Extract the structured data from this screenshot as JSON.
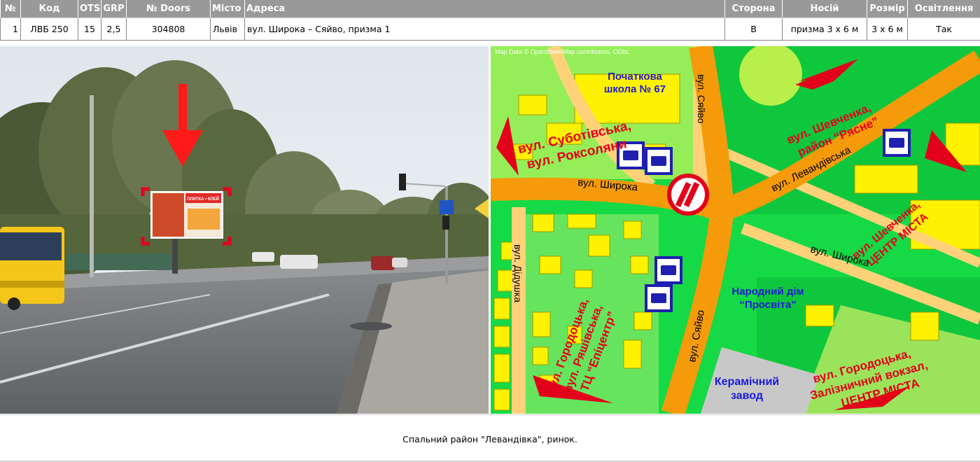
{
  "table": {
    "headers": [
      "№",
      "Код",
      "OTS",
      "GRP",
      "№ Doors",
      "Місто",
      "Адреса",
      "Сторона",
      "Носій",
      "Розмір",
      "Освітлення"
    ],
    "row": {
      "num": "1",
      "code": "ЛВБ 250",
      "ots": "15",
      "grp": "2,5",
      "doors": "304808",
      "city": "Львів",
      "address": "вул. Широка – Сяйво, призма 1",
      "side": "В",
      "carrier": "призма 3 х 6 м",
      "size": "3 х 6 м",
      "lighting": "Так"
    }
  },
  "billboard": {
    "brand_text": "ПЛИТКА • КЛЕЙ"
  },
  "map": {
    "attribution": "Map Data © OpenStreetMap contributors, ODbL",
    "labels": {
      "school_line1": "Початкова",
      "school_line2": "школа № 67",
      "subotivska_line1": "вул. Суботівська,",
      "subotivska_line2": "вул. Роксоляни",
      "shevchenka_top_line1": "вул. Шевченка,",
      "shevchenka_top_line2": "район “Рясне”",
      "syaivo_top": "вул. Сяйво",
      "levandivska": "вул. Левандівська",
      "shyroka_left": "вул. Широка",
      "shevchenka_right_line1": "вул. Шевченка,",
      "shevchenka_right_line2": "ЦЕНТР МІСТА",
      "shyroka_right": "вул. Широка",
      "didushka": "вул. Дідушка",
      "gorodotska_left_line1": "вул. Городоцька,",
      "gorodotska_left_line2": "вул. Ряшівська,",
      "gorodotska_left_line3": "ТЦ “Епіцентр”",
      "syaivo_bottom": "вул. Сяйво",
      "narodnyi_line1": "Народний дім",
      "narodnyi_line2": "“Просвіта”",
      "ceramic_line1": "Керамічний",
      "ceramic_line2": "завод",
      "gorodotska_right_line1": "вул. Городоцька,",
      "gorodotska_right_line2": "Залізничний вокзал,",
      "gorodotska_right_line3": "ЦЕНТР МІСТА"
    }
  },
  "caption": "Спальний район \"Левандівка\", ринок.",
  "colors": {
    "header_bg": "#999999",
    "map_green": "#16d946",
    "map_dark_green": "#0cb334",
    "map_road": "#ffd27a",
    "map_main_road": "#f59b0b",
    "map_building": "#fff200",
    "map_label_red": "#e3001b",
    "map_label_blue": "#1b1bd6",
    "arrow_red": "#e3001b"
  }
}
